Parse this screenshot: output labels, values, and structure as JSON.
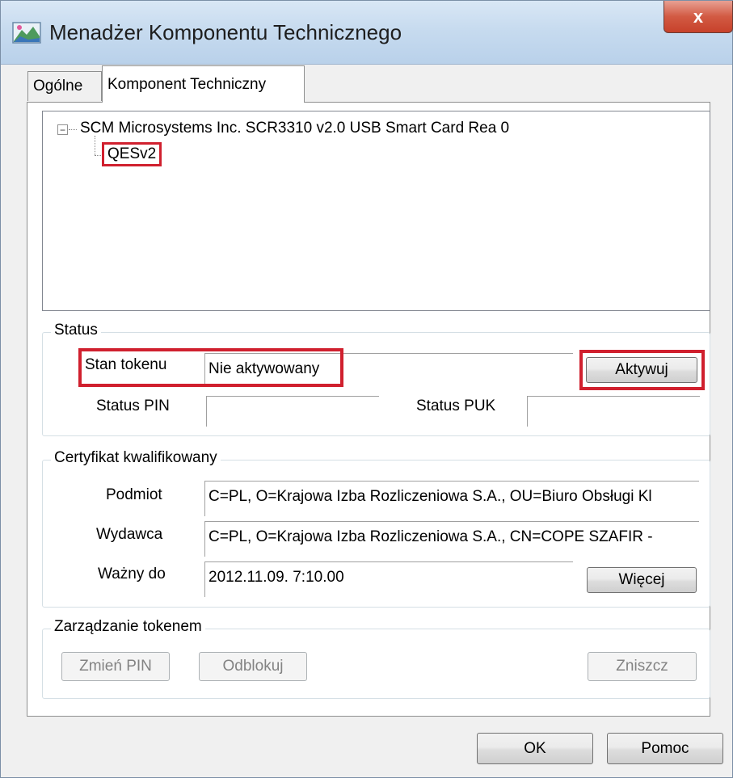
{
  "window": {
    "title": "Menadżer Komponentu Technicznego",
    "close_label": "x"
  },
  "tabs": [
    {
      "label": "Ogólne",
      "selected": false
    },
    {
      "label": "Komponent Techniczny",
      "selected": true
    }
  ],
  "tree": {
    "root": "SCM Microsystems Inc. SCR3310 v2.0 USB Smart Card Rea 0",
    "expander": "−",
    "child": "QESv2"
  },
  "status": {
    "group_title": "Status",
    "token_state_label": "Stan tokenu",
    "token_state_value": "Nie aktywowany",
    "activate_button": "Aktywuj",
    "pin_status_label": "Status PIN",
    "pin_status_value": "",
    "puk_status_label": "Status PUK",
    "puk_status_value": ""
  },
  "certificate": {
    "group_title": "Certyfikat kwalifikowany",
    "subject_label": "Podmiot",
    "subject_value": "C=PL, O=Krajowa Izba Rozliczeniowa S.A., OU=Biuro Obsługi Kl",
    "issuer_label": "Wydawca",
    "issuer_value": "C=PL, O=Krajowa Izba Rozliczeniowa S.A., CN=COPE SZAFIR -",
    "valid_to_label": "Ważny do",
    "valid_to_value": "2012.11.09. 7:10.00",
    "more_button": "Więcej"
  },
  "token_management": {
    "group_title": "Zarządzanie tokenem",
    "change_pin_button": "Zmień PIN",
    "unblock_button": "Odblokuj",
    "destroy_button": "Zniszcz"
  },
  "footer": {
    "ok_button": "OK",
    "help_button": "Pomoc"
  },
  "colors": {
    "highlight": "#d0202e",
    "titlebar": "#c7dbef",
    "close_button": "#c7412b"
  }
}
